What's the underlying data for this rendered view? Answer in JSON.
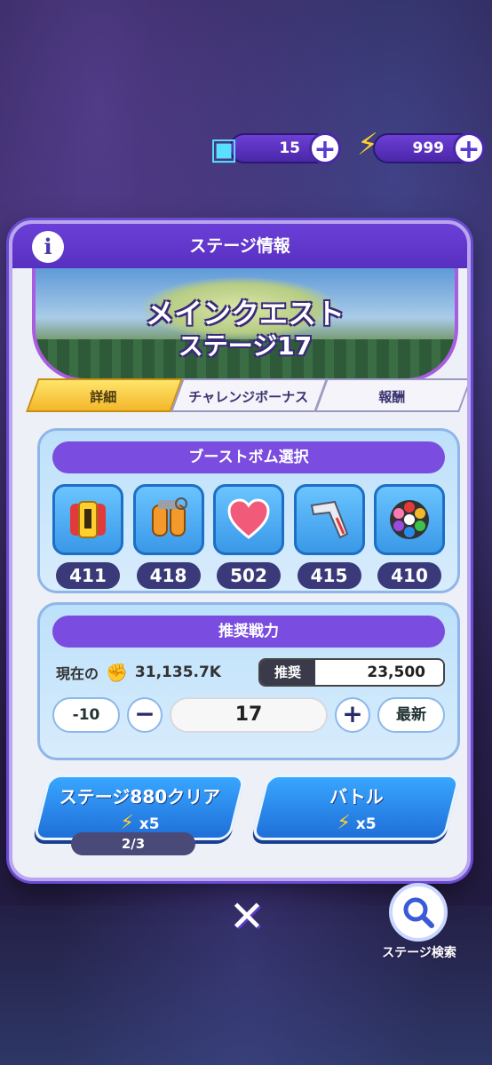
{
  "currency": {
    "tickets": "15",
    "energy": "999",
    "ticket_icon": "ticket-icon",
    "energy_icon": "lightning-icon"
  },
  "panel": {
    "title": "ステージ情報",
    "info_icon_label": "i",
    "banner_title": "メインクエスト",
    "banner_subtitle": "ステージ17",
    "tabs": [
      "詳細",
      "チャレンジボーナス",
      "報酬"
    ],
    "active_tab": 0
  },
  "boost": {
    "title": "ブーストボム選択",
    "bombs": [
      {
        "icon": "battery-bomb-icon",
        "count": "411"
      },
      {
        "icon": "jetpack-bomb-icon",
        "count": "418"
      },
      {
        "icon": "heart-bomb-icon",
        "count": "502"
      },
      {
        "icon": "boomerang-bomb-icon",
        "count": "415"
      },
      {
        "icon": "color-wheel-bomb-icon",
        "count": "410"
      }
    ]
  },
  "power": {
    "title": "推奨戦力",
    "current_label": "現在の",
    "current_value": "31,135.7K",
    "recommended_label": "推奨",
    "recommended_value": "23,500"
  },
  "stepper": {
    "minus10": "-10",
    "minus": "−",
    "stage": "17",
    "plus": "+",
    "latest": "最新"
  },
  "actions": {
    "clear_label": "ステージ880クリア",
    "clear_cost": "x5",
    "clear_progress": "2/3",
    "battle_label": "バトル",
    "battle_cost": "x5"
  },
  "footer": {
    "close": "✕",
    "search_label": "ステージ検索"
  }
}
